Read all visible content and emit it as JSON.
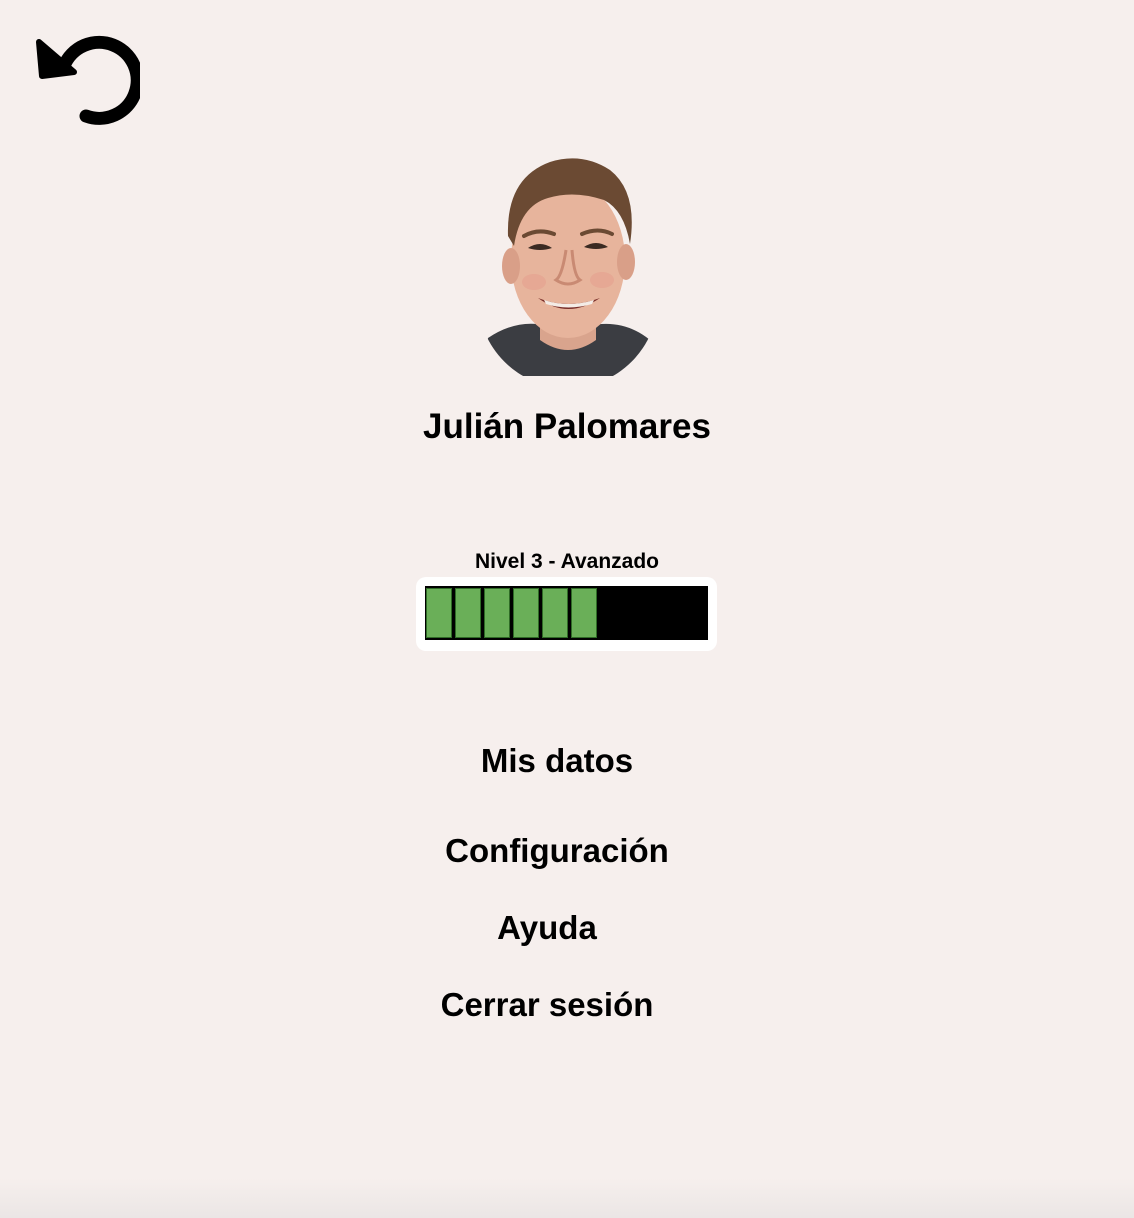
{
  "header": {
    "back_icon": "undo-arrow-icon"
  },
  "profile": {
    "avatar_icon": "user-photo",
    "name": "Julián Palomares"
  },
  "level": {
    "label": "Nivel 3 - Avanzado",
    "filled_segments": 6,
    "total_segments": 10,
    "fill_color": "#6aaf58",
    "empty_color": "#000000"
  },
  "menu": {
    "items": [
      {
        "label": "Mis datos"
      },
      {
        "label": "Configuración"
      },
      {
        "label": "Ayuda"
      },
      {
        "label": "Cerrar sesión"
      }
    ]
  },
  "colors": {
    "background": "#f6efed",
    "text": "#000000"
  }
}
